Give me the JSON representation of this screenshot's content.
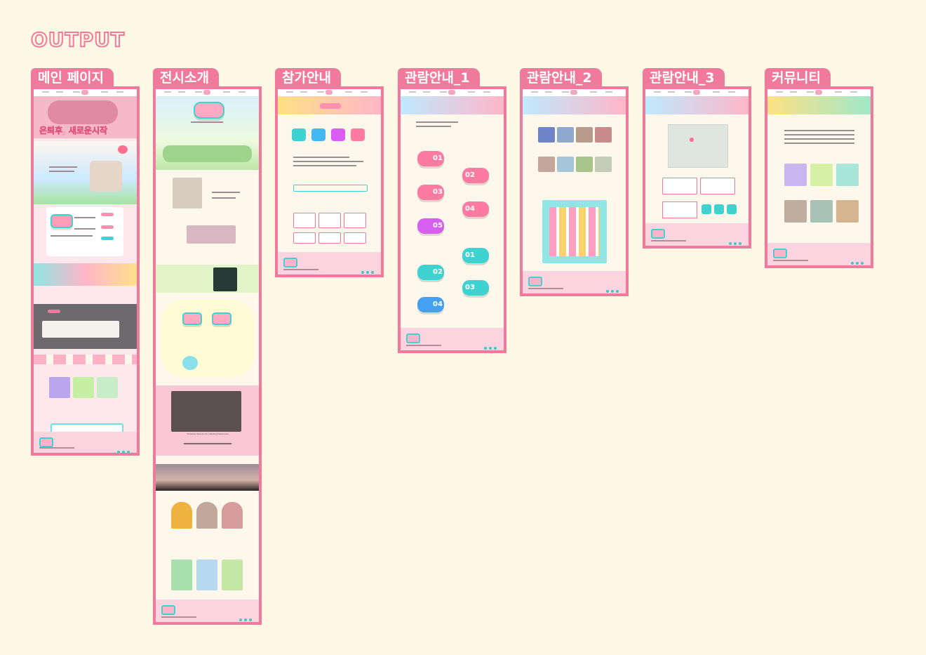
{
  "header": {
    "title": "OUTPUT"
  },
  "pages": [
    {
      "label": "메인 페이지",
      "hero_text": "은퇴후, 새로운시작"
    },
    {
      "label": "전시소개",
      "video_caption": "Timeless Spaces For Lifelong Happiness"
    },
    {
      "label": "참가안내"
    },
    {
      "label": "관람안내_1",
      "steps_left": [
        "01",
        "02",
        "03",
        "04",
        "05"
      ],
      "steps_right": [
        "01",
        "02",
        "03",
        "04"
      ]
    },
    {
      "label": "관람안내_2"
    },
    {
      "label": "관람안내_3"
    },
    {
      "label": "커뮤니티"
    }
  ],
  "colors": {
    "accent": "#f07a9c",
    "mint": "#3ed3d0",
    "background": "#fdf8e3"
  }
}
